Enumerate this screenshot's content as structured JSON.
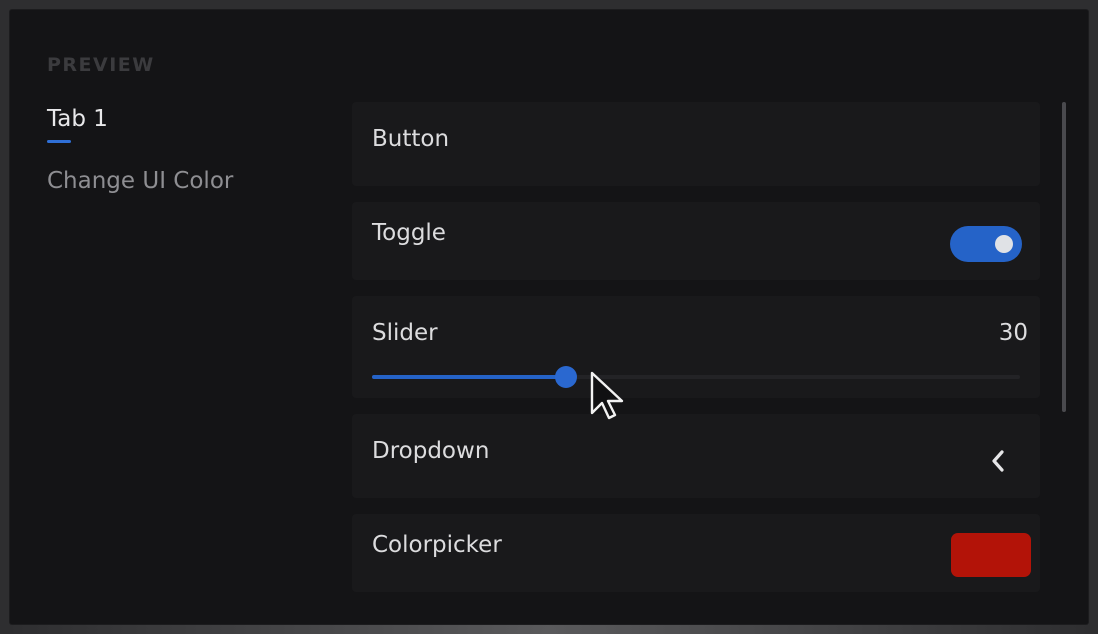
{
  "sidebar": {
    "section_label": "PREVIEW",
    "tabs": [
      {
        "label": "Tab 1",
        "active": true
      },
      {
        "label": "Change UI Color",
        "active": false
      }
    ]
  },
  "controls": {
    "button": {
      "label": "Button"
    },
    "toggle": {
      "label": "Toggle",
      "state": "on"
    },
    "slider": {
      "label": "Slider",
      "value": "30",
      "fill_fraction": 0.3
    },
    "dropdown": {
      "label": "Dropdown",
      "icon": "chevron-left-icon"
    },
    "colorpicker": {
      "label": "Colorpicker",
      "color": "#b31308"
    }
  },
  "colors": {
    "accent": "#2563c8",
    "background": "#141416",
    "row_background": "#19191b"
  }
}
